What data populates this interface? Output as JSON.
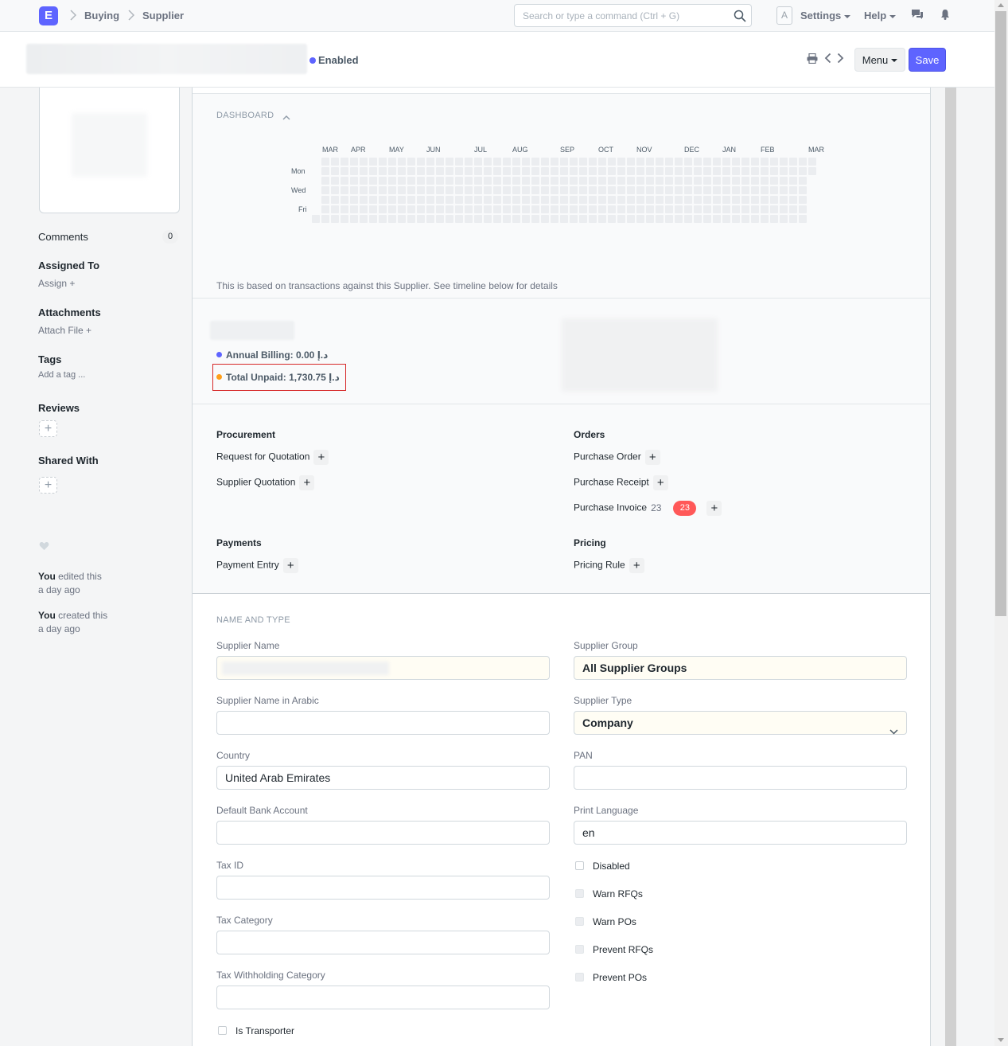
{
  "navbar": {
    "logo": "E",
    "breadcrumbs": [
      "Buying",
      "Supplier"
    ],
    "search_placeholder": "Search or type a command (Ctrl + G)",
    "avatar_letter": "A",
    "settings_label": "Settings",
    "help_label": "Help"
  },
  "page_head": {
    "status": "Enabled",
    "menu_label": "Menu",
    "save_label": "Save"
  },
  "sidebar": {
    "comments_label": "Comments",
    "comments_count": "0",
    "assigned_to_label": "Assigned To",
    "assign_label": "Assign",
    "attachments_label": "Attachments",
    "attach_file_label": "Attach File",
    "tags_label": "Tags",
    "add_tag_label": "Add a tag ...",
    "reviews_label": "Reviews",
    "shared_with_label": "Shared With",
    "timeline": [
      {
        "who": "You",
        "action": " edited this",
        "when": "a day ago"
      },
      {
        "who": "You",
        "action": " created this",
        "when": "a day ago"
      }
    ]
  },
  "dashboard": {
    "title": "DASHBOARD",
    "months": [
      "MAR",
      "APR",
      "MAY",
      "JUN",
      "JUL",
      "AUG",
      "SEP",
      "OCT",
      "NOV",
      "DEC",
      "JAN",
      "FEB",
      "MAR"
    ],
    "weekdays": [
      "Mon",
      "Wed",
      "Fri"
    ],
    "note": "This is based on transactions against this Supplier. See timeline below for details"
  },
  "stats": {
    "annual_billing": "Annual Billing: 0.00 د.إ",
    "total_unpaid": "Total Unpaid: 1,730.75 د.إ",
    "annual_color": "#5e64ff",
    "unpaid_color": "#ff9f1a"
  },
  "links": {
    "procurement": {
      "title": "Procurement",
      "items": [
        "Request for Quotation",
        "Supplier Quotation"
      ]
    },
    "orders": {
      "title": "Orders",
      "items": [
        "Purchase Order",
        "Purchase Receipt",
        "Purchase Invoice"
      ],
      "invoice_count": "23",
      "invoice_badge": "23"
    },
    "payments": {
      "title": "Payments",
      "items": [
        "Payment Entry"
      ]
    },
    "pricing": {
      "title": "Pricing",
      "items": [
        "Pricing Rule"
      ]
    }
  },
  "form": {
    "section_title": "NAME AND TYPE",
    "supplier_name_label": "Supplier Name",
    "supplier_group_label": "Supplier Group",
    "supplier_group_value": "All Supplier Groups",
    "supplier_name_arabic_label": "Supplier Name in Arabic",
    "supplier_type_label": "Supplier Type",
    "supplier_type_value": "Company",
    "country_label": "Country",
    "country_value": "United Arab Emirates",
    "pan_label": "PAN",
    "default_bank_label": "Default Bank Account",
    "print_language_label": "Print Language",
    "print_language_value": "en",
    "tax_id_label": "Tax ID",
    "tax_category_label": "Tax Category",
    "tax_withholding_label": "Tax Withholding Category",
    "is_transporter_label": "Is Transporter",
    "checks": [
      "Disabled",
      "Warn RFQs",
      "Warn POs",
      "Prevent RFQs",
      "Prevent POs"
    ]
  }
}
